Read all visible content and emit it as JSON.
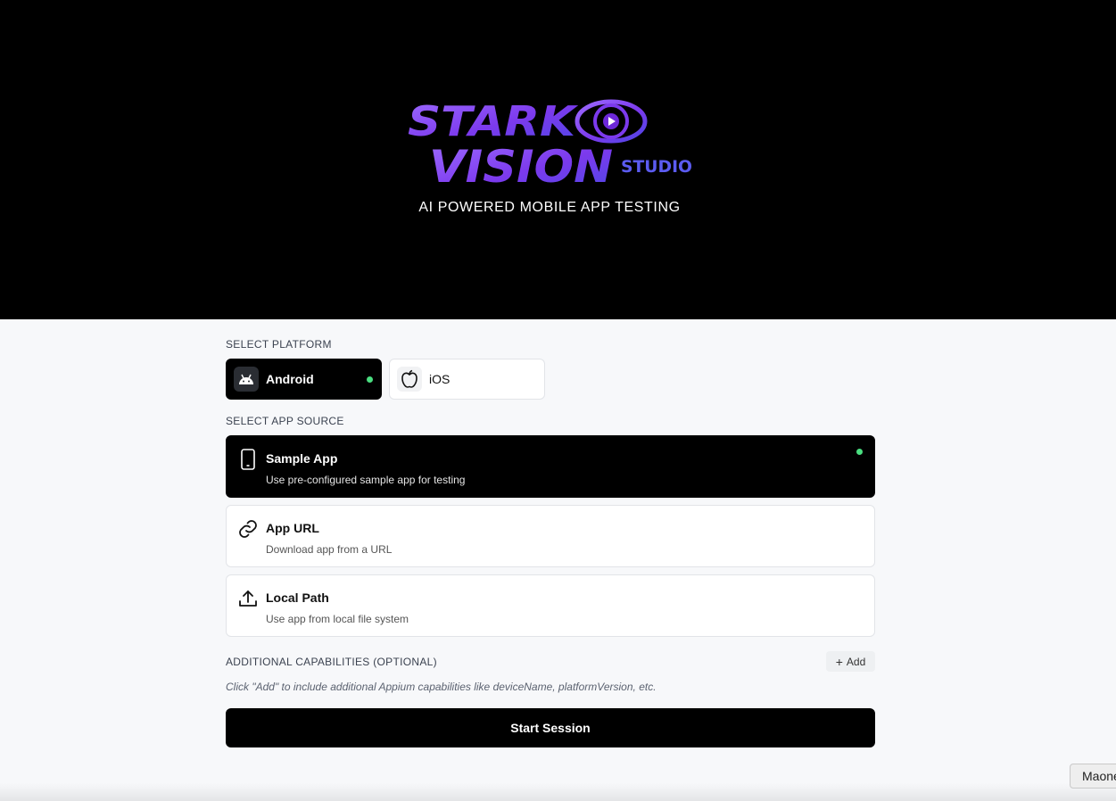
{
  "hero": {
    "logo_line1": "STARK",
    "logo_line2": "VISION",
    "logo_studio": "STUDIO",
    "tagline": "AI POWERED MOBILE APP TESTING",
    "logo_gradient": [
      "#8b5cf6",
      "#6d28d9",
      "#4f46e5"
    ]
  },
  "platform": {
    "label": "SELECT PLATFORM",
    "options": [
      {
        "label": "Android",
        "icon": "android-icon",
        "selected": true
      },
      {
        "label": "iOS",
        "icon": "apple-icon",
        "selected": false
      }
    ]
  },
  "app_source": {
    "label": "SELECT APP SOURCE",
    "options": [
      {
        "title": "Sample App",
        "description": "Use pre-configured sample app for testing",
        "icon": "phone-icon",
        "selected": true
      },
      {
        "title": "App URL",
        "description": "Download app from a URL",
        "icon": "link-icon",
        "selected": false
      },
      {
        "title": "Local Path",
        "description": "Use app from local file system",
        "icon": "upload-icon",
        "selected": false
      }
    ]
  },
  "capabilities": {
    "label": "ADDITIONAL CAPABILITIES (OPTIONAL)",
    "add_label": "Add",
    "hint": "Click \"Add\" to include additional Appium capabilities like deviceName, platformVersion, etc."
  },
  "start_label": "Start Session",
  "tooltip": "Maone",
  "colors": {
    "selected_bg": "#000000",
    "status_dot": "#4ade80",
    "page_bg": "#f7f8fa"
  }
}
